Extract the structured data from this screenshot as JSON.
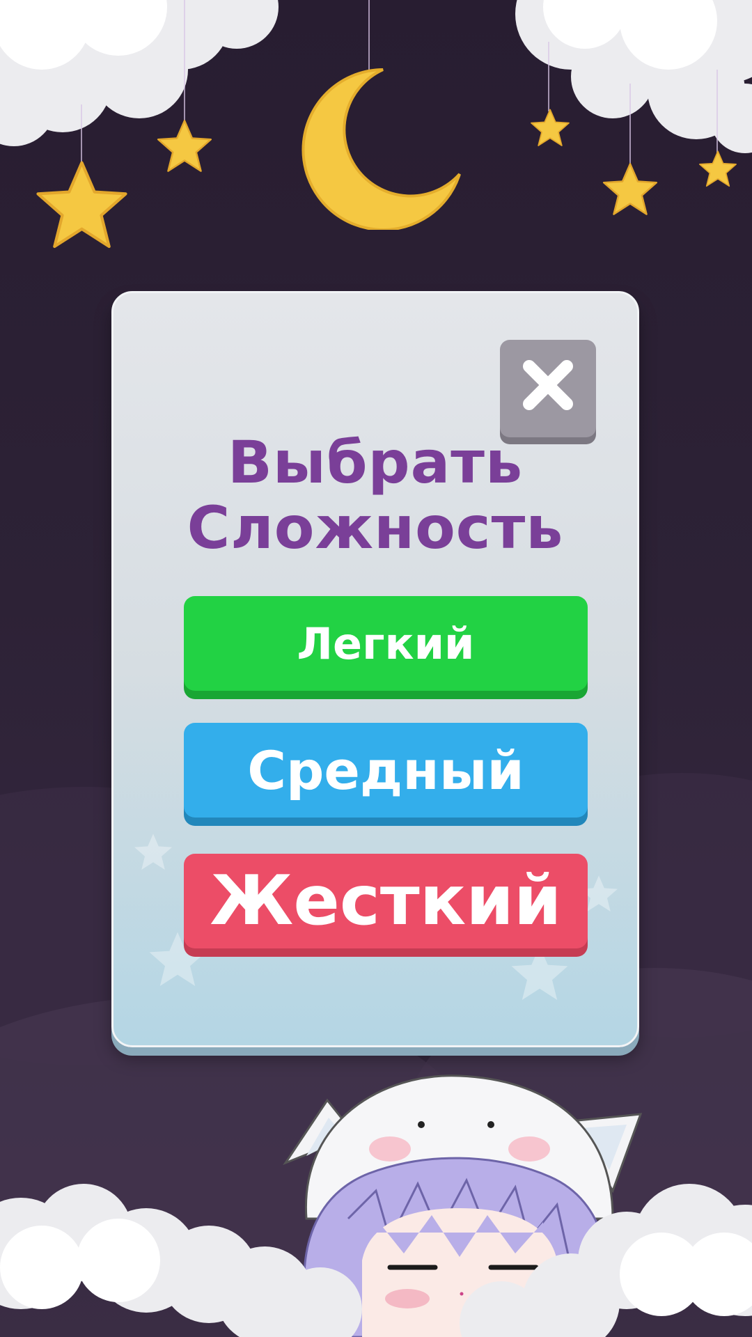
{
  "dialog": {
    "title_line1": "Выбрать",
    "title_line2": "Сложность",
    "close_symbol": "✕"
  },
  "difficulty_buttons": [
    {
      "label": "Легкий",
      "color": "#22d244"
    },
    {
      "label": "Средный",
      "color": "#33aeeb"
    },
    {
      "label": "Жесткий",
      "color": "#ec4d67"
    }
  ],
  "colors": {
    "background": "#2a1f33",
    "panel": "#dde2e6",
    "title": "#7a3f98",
    "close_button": "#9c98a2",
    "star": "#f5c842"
  },
  "decorations": {
    "top": [
      "cloud-icon",
      "moon-icon",
      "star-icon"
    ],
    "bottom": [
      "cloud-icon",
      "anime-girl-character"
    ]
  }
}
